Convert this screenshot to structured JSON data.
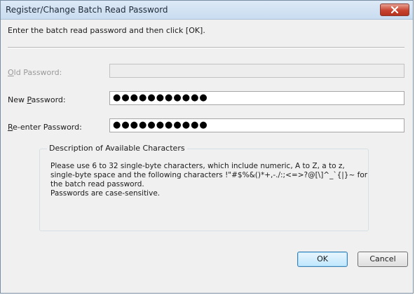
{
  "window": {
    "title": "Register/Change Batch Read Password",
    "close_icon": "close-icon"
  },
  "instruction": "Enter the batch read password and then click [OK].",
  "fields": [
    {
      "label_mnemonic": "O",
      "label_rest": "ld Password:",
      "value": "",
      "disabled": true
    },
    {
      "label_prefix": "New ",
      "label_mnemonic": "P",
      "label_rest": "assword:",
      "value": "●●●●●●●●●●●",
      "disabled": false
    },
    {
      "label_mnemonic": "R",
      "label_rest": "e-enter Password:",
      "value": "●●●●●●●●●●●",
      "disabled": false
    }
  ],
  "description": {
    "title": "Description of Available Characters",
    "lines": [
      "Please use 6 to 32 single-byte characters, which include numeric, A to Z, a to z,",
      "single-byte space and the following characters !\"#$%&()*+,-./:;<=>?@[\\]^_`{|}~ for",
      "the batch read password.",
      "Passwords are case-sensitive."
    ]
  },
  "buttons": {
    "ok": "OK",
    "cancel": "Cancel"
  },
  "colors": {
    "close_button": "#c7432f",
    "default_button_border": "#3c7fb1"
  }
}
